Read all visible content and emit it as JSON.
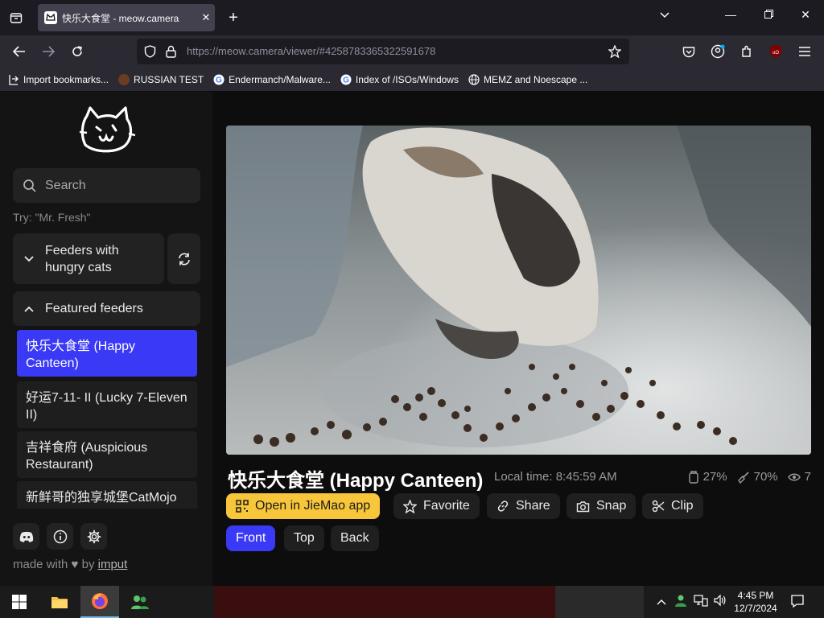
{
  "browser": {
    "tab_title": "快乐大食堂 - meow.camera",
    "url_host": "https://meow.camera",
    "url_path": "/viewer/#4258783365322591678",
    "bookmarks": [
      {
        "label": "Import bookmarks...",
        "icon": "import-icon"
      },
      {
        "label": "RUSSIAN TEST",
        "icon": "site-icon"
      },
      {
        "label": "Endermanch/Malware...",
        "icon": "google-icon"
      },
      {
        "label": "Index of /ISOs/Windows",
        "icon": "google-icon"
      },
      {
        "label": "MEMZ and Noescape ...",
        "icon": "globe-icon"
      }
    ]
  },
  "sidebar": {
    "search_placeholder": "Search",
    "try_hint": "Try: \"Mr. Fresh\"",
    "groups": {
      "hungry": "Feeders with hungry cats",
      "featured": "Featured feeders"
    },
    "feeders": [
      {
        "label": "快乐大食堂 (Happy Canteen)",
        "active": true
      },
      {
        "label": "好运7-11- II (Lucky 7-Eleven II)",
        "active": false
      },
      {
        "label": "吉祥食府 (Auspicious Restaurant)",
        "active": false
      },
      {
        "label": "新鲜哥的独享城堡CatMojo",
        "active": false
      }
    ],
    "made_with_prefix": "made with",
    "made_with_by": "by",
    "made_with_link": "imput"
  },
  "viewer": {
    "title": "快乐大食堂 (Happy Canteen)",
    "local_time_label": "Local time:",
    "local_time": "8:45:59 AM",
    "stats": {
      "food": "27%",
      "clean": "70%",
      "viewers": "7"
    },
    "actions": {
      "open_app": "Open in JieMao app",
      "favorite": "Favorite",
      "share": "Share",
      "snap": "Snap",
      "clip": "Clip"
    },
    "cameras": [
      "Front",
      "Top",
      "Back"
    ],
    "active_camera": "Front"
  },
  "taskbar": {
    "time": "4:45 PM",
    "date": "12/7/2024"
  },
  "colors": {
    "accent_blue": "#3a39f5",
    "yellow": "#f7c63a"
  }
}
